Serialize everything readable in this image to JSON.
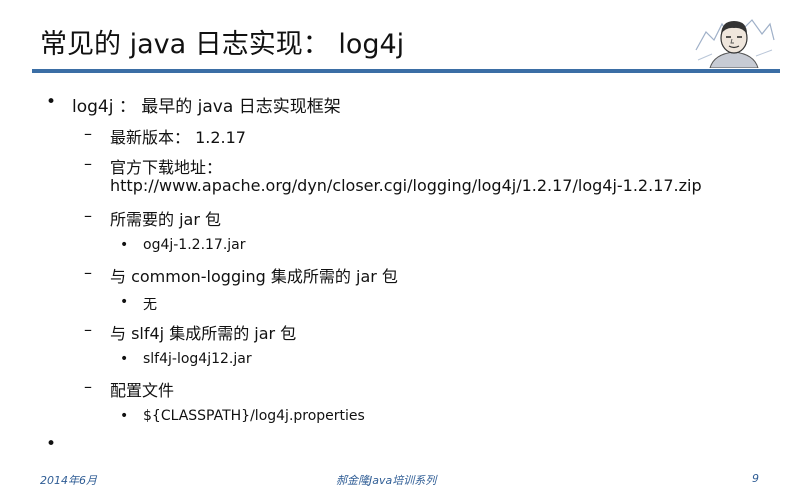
{
  "slide": {
    "title": "常见的 java 日志实现： log4j",
    "bullets": [
      {
        "text": "log4j ： 最早的 java 日志实现框架",
        "children": [
          {
            "text": "最新版本： 1.2.17"
          },
          {
            "text": "官方下载地址：",
            "continuation": "http://www.apache.org/dyn/closer.cgi/logging/log4j/1.2.17/log4j-1.2.17.zip"
          },
          {
            "text": "所需要的 jar 包",
            "children": [
              {
                "text": "og4j-1.2.17.jar"
              }
            ]
          },
          {
            "text": "与 common-logging 集成所需的 jar 包",
            "children": [
              {
                "text": "无"
              }
            ]
          },
          {
            "text": "与 slf4j 集成所需的 jar 包",
            "children": [
              {
                "text": "slf4j-log4j12.jar"
              }
            ]
          },
          {
            "text": "配置文件",
            "children": [
              {
                "text": "${CLASSPATH}/log4j.properties"
              }
            ]
          }
        ]
      },
      {
        "text": ""
      }
    ],
    "markers": {
      "level1": "•",
      "level2": "–",
      "level3": "•"
    }
  },
  "footer": {
    "date": "2014年6月",
    "center": "郝金隆Java培训系列",
    "page": "9"
  }
}
